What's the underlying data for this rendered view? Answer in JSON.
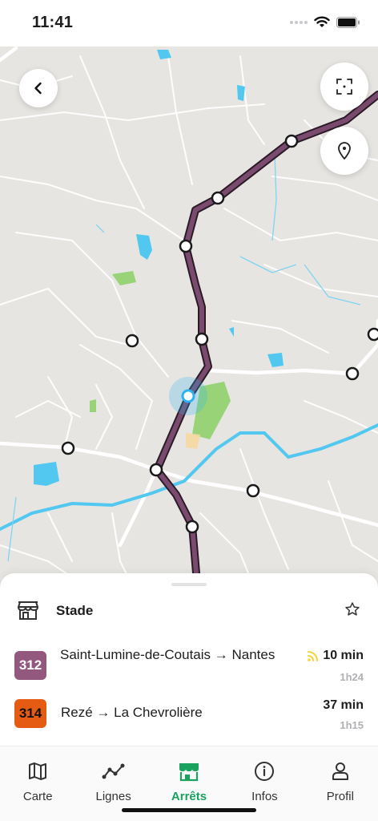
{
  "status_bar": {
    "time": "11:41"
  },
  "map": {
    "controls": [
      "back",
      "focus-area",
      "locate"
    ],
    "colors": {
      "route": "#7a4b6e",
      "route_outline": "#2b1b27",
      "water": "#52c7ef",
      "park": "#90d36e",
      "user": "#2bb2f0"
    }
  },
  "stop": {
    "name": "Stade"
  },
  "departures": [
    {
      "line": "312",
      "line_color": "#92587e",
      "destination": "Saint-Lumine-de-Coutais → Nantes",
      "time": "10 min",
      "realtime": true,
      "sub": "1h24"
    },
    {
      "line": "314",
      "line_color": "#e65b13",
      "destination": "Rezé → La Chevrolière",
      "time": "37 min",
      "realtime": false,
      "sub": "1h15"
    }
  ],
  "tabs": [
    {
      "label": "Carte",
      "icon": "map-icon"
    },
    {
      "label": "Lignes",
      "icon": "route-icon"
    },
    {
      "label": "Arrêts",
      "icon": "stop-icon",
      "active": true
    },
    {
      "label": "Infos",
      "icon": "info-icon"
    },
    {
      "label": "Profil",
      "icon": "person-icon"
    }
  ]
}
